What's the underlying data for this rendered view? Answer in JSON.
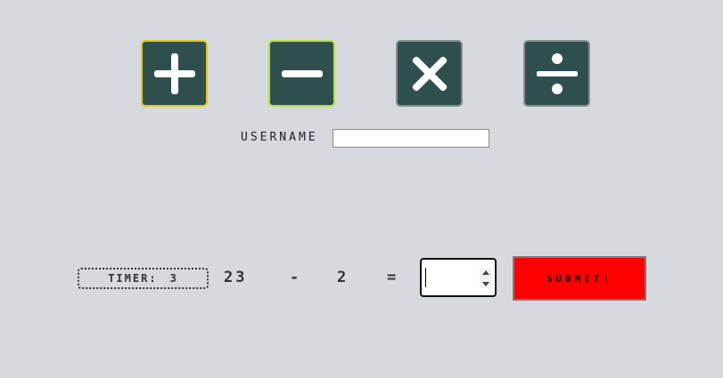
{
  "operations": [
    {
      "name": "add",
      "icon": "plus-icon",
      "border_color": "#e6c619"
    },
    {
      "name": "subtract",
      "icon": "minus-icon",
      "border_color": "#b8df3a"
    },
    {
      "name": "multiply",
      "icon": "times-icon",
      "border_color": "#8c8c8c"
    },
    {
      "name": "divide",
      "icon": "divide-icon",
      "border_color": "#8c8c8c"
    }
  ],
  "colors": {
    "background": "#d6d9dd",
    "op_button_fill": "#2f4f4f",
    "submit_fill": "#ff0000"
  },
  "username": {
    "label": "USERNAME",
    "value": ""
  },
  "timer": {
    "label": "TIMER:",
    "value": "3"
  },
  "equation": {
    "operand_a": "23",
    "operator": "-",
    "operand_b": "2",
    "equals": "="
  },
  "answer": {
    "value": ""
  },
  "submit": {
    "label": "SUBMIT!"
  }
}
